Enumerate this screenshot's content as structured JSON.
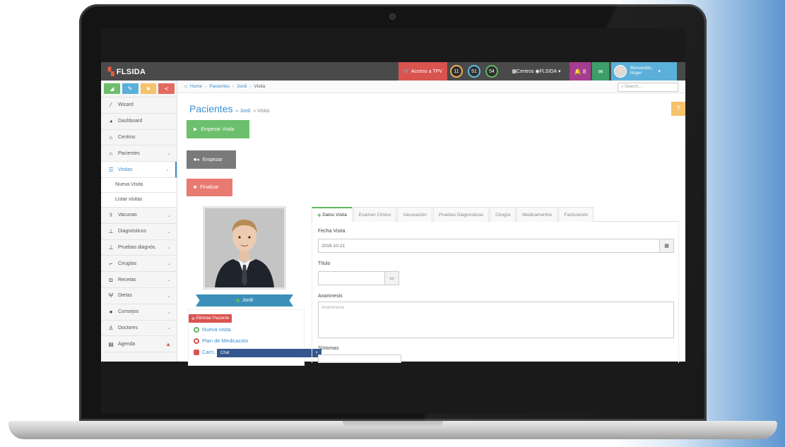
{
  "app": {
    "brand": "FLSIDA",
    "tpv_label": "Acceso a TPV",
    "counters": [
      "11",
      "51",
      "54"
    ],
    "centros_label": "Centros",
    "centro_name": "FLSIDA",
    "notif_count": "8",
    "user_greeting": "Bienvenido,",
    "user_name": "Roger"
  },
  "sidebar": {
    "items": [
      {
        "label": "Wizard",
        "icon": "wand-icon"
      },
      {
        "label": "Dashboard",
        "icon": "dashboard-icon"
      },
      {
        "label": "Centros",
        "icon": "home-icon"
      },
      {
        "label": "Pacientes",
        "icon": "paw-icon"
      },
      {
        "label": "Visitas",
        "icon": "list-icon"
      },
      {
        "label": "Nueva Visita",
        "icon": ""
      },
      {
        "label": "Listar visitas",
        "icon": ""
      },
      {
        "label": "Vacunas",
        "icon": "syringe-icon"
      },
      {
        "label": "Diagnósticos",
        "icon": "flask-icon"
      },
      {
        "label": "Pruebas diagnós.",
        "icon": "flask-icon"
      },
      {
        "label": "Cirugías",
        "icon": "scalpel-icon"
      },
      {
        "label": "Recetas",
        "icon": "camera-icon"
      },
      {
        "label": "Dietas",
        "icon": "cutlery-icon"
      },
      {
        "label": "Consejos",
        "icon": "chat-icon"
      },
      {
        "label": "Doctores",
        "icon": "user-icon"
      },
      {
        "label": "Agenda",
        "icon": "calendar-icon"
      }
    ]
  },
  "breadcrumb": {
    "home": "Home",
    "pacientes": "Pacientes",
    "patient": "Jordi",
    "current": "Visita"
  },
  "search_placeholder": "Search...",
  "page": {
    "title": "Pacientes",
    "sub1": "» Jordi",
    "sub2": "» Visita",
    "help": "?"
  },
  "buttons": {
    "start_visit": "Empezar Visita",
    "start": "Empezar",
    "finish": "Finalizar"
  },
  "patient": {
    "name": "Jordi"
  },
  "actions": {
    "delete_patient": "Eliminar Paciente",
    "new_visit": "Nueva visita",
    "medication_plan": "Plan de Medicación",
    "more": "Carri..."
  },
  "chat": {
    "title": "Chat",
    "close": "×"
  },
  "tabs": [
    "Datos Visita",
    "Examen Clínico",
    "Vacunación",
    "Pruebas Diagnósticas",
    "Cirugía",
    "Medicamentos",
    "Facturación"
  ],
  "form": {
    "fecha_label": "Fecha Visita",
    "fecha_value": "2016-10-21",
    "titulo_label": "Título",
    "anamnesis_label": "Anamnesis",
    "anamnesis_placeholder": "Anamnesis",
    "sintomas_label": "Síntomas"
  },
  "colors": {
    "accent": "#3a8fcf",
    "topbar": "#4a4a4a",
    "success": "#6cbf6c",
    "danger": "#d9534f"
  }
}
